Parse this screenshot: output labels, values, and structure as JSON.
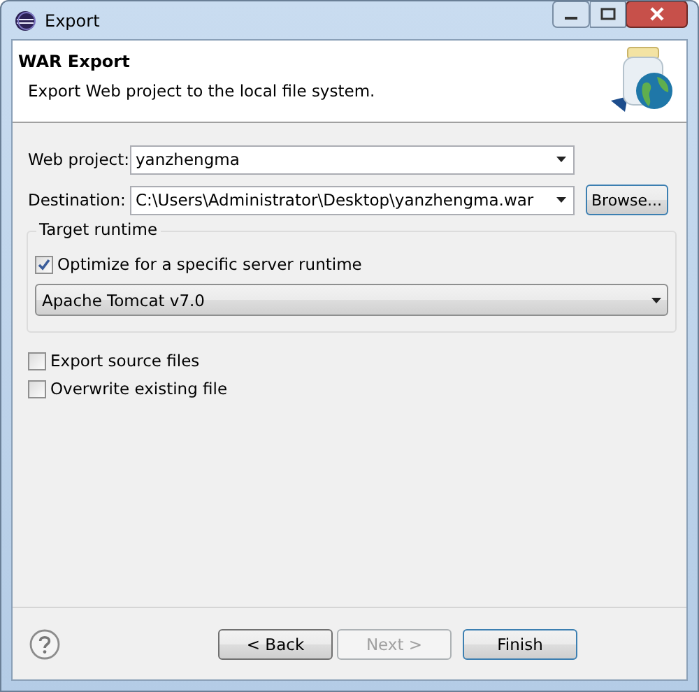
{
  "window": {
    "title": "Export"
  },
  "header": {
    "title": "WAR Export",
    "description": "Export Web project to the local file system."
  },
  "fields": [
    {
      "label": "Web project:",
      "value": "yanzhengma"
    },
    {
      "label": "Destination:",
      "value": "C:\\Users\\Administrator\\Desktop\\yanzhengma.war",
      "button": "Browse..."
    }
  ],
  "target_runtime": {
    "title": "Target runtime",
    "option": {
      "label": "Optimize for a specific server runtime",
      "checked": true
    },
    "runtime": "Apache Tomcat v7.0"
  },
  "options": [
    {
      "label": "Export source files",
      "checked": false
    },
    {
      "label": "Overwrite existing file",
      "checked": false
    }
  ],
  "buttons": [
    {
      "label": "< Back",
      "disabled": false
    },
    {
      "label": "Next >",
      "disabled": true
    },
    {
      "label": "Finish",
      "disabled": false
    }
  ]
}
